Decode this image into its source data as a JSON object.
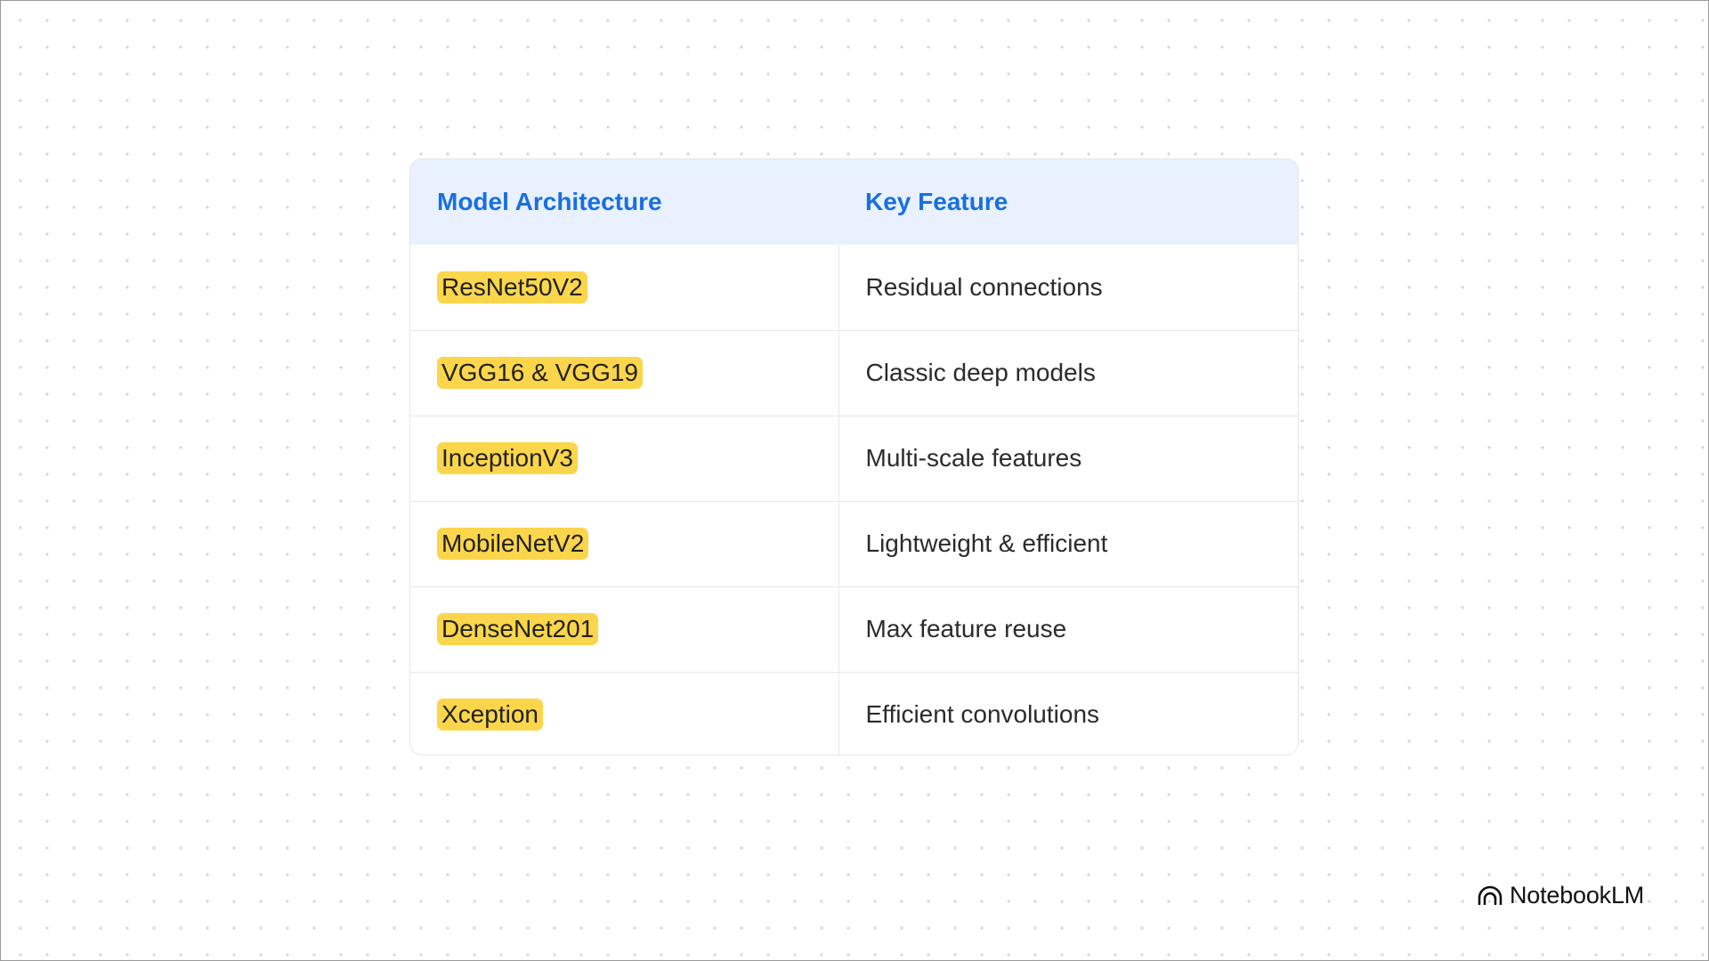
{
  "table": {
    "headers": {
      "model": "Model Architecture",
      "feature": "Key Feature"
    },
    "rows": [
      {
        "model": "ResNet50V2",
        "feature": "Residual connections"
      },
      {
        "model": "VGG16 & VGG19",
        "feature": "Classic deep models"
      },
      {
        "model": "InceptionV3",
        "feature": "Multi-scale features"
      },
      {
        "model": "MobileNetV2",
        "feature": "Lightweight & efficient"
      },
      {
        "model": "DenseNet201",
        "feature": "Max feature reuse"
      },
      {
        "model": "Xception",
        "feature": "Efficient convolutions"
      }
    ]
  },
  "brand": {
    "name": "NotebookLM",
    "icon": "notebooklm-logo-icon"
  },
  "colors": {
    "header_text": "#1a6fe0",
    "header_bg": "#e8f1fd",
    "highlight": "#fcd64a"
  }
}
